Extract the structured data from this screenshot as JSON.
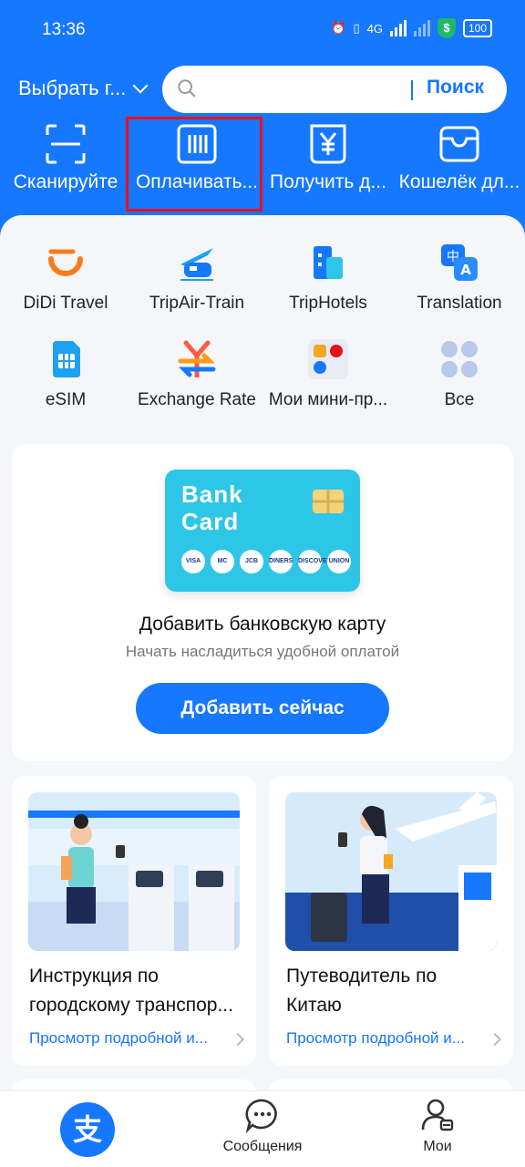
{
  "status_bar": {
    "time": "13:36",
    "network": "4G",
    "battery": "100"
  },
  "header": {
    "city_select": "Выбрать г...",
    "search_placeholder": "",
    "search_button": "Поиск"
  },
  "quick_actions": [
    {
      "label": "Сканируйте",
      "icon": "scan-icon"
    },
    {
      "label": "Оплачивать...",
      "icon": "pay-code-icon"
    },
    {
      "label": "Получить д...",
      "icon": "receive-money-icon"
    },
    {
      "label": "Кошелёк дл...",
      "icon": "wallet-icon"
    }
  ],
  "services": [
    {
      "label": "DiDi Travel",
      "icon": "didi-icon"
    },
    {
      "label": "TripAir-Train",
      "icon": "plane-train-icon"
    },
    {
      "label": "TripHotels",
      "icon": "hotel-icon"
    },
    {
      "label": "Translation",
      "icon": "translate-icon"
    },
    {
      "label": "eSIM",
      "icon": "esim-icon"
    },
    {
      "label": "Exchange Rate",
      "icon": "exchange-rate-icon"
    },
    {
      "label": "Мои мини-пр...",
      "icon": "mini-programs-icon"
    },
    {
      "label": "Все",
      "icon": "all-apps-icon"
    }
  ],
  "bank_card": {
    "card_text_line1": "Bank",
    "card_text_line2": "Card",
    "logos": [
      "VISA",
      "MC",
      "JCB",
      "DINERS",
      "DISCOVER",
      "UNION"
    ],
    "title": "Добавить банковскую карту",
    "subtitle": "Начать насладиться удобной оплатой",
    "button": "Добавить сейчас"
  },
  "guides": [
    {
      "title_line1": "Инструкция по",
      "title_line2": "городскому транспор...",
      "link": "Просмотр подробной и..."
    },
    {
      "title_line1": "Путеводитель по",
      "title_line2": "Китаю",
      "link": "Просмотр подробной и..."
    }
  ],
  "bottom_nav": {
    "home_glyph": "支",
    "messages": "Сообщения",
    "me": "Мои"
  },
  "colors": {
    "primary": "#1677ff",
    "highlight": "#e8101b"
  }
}
